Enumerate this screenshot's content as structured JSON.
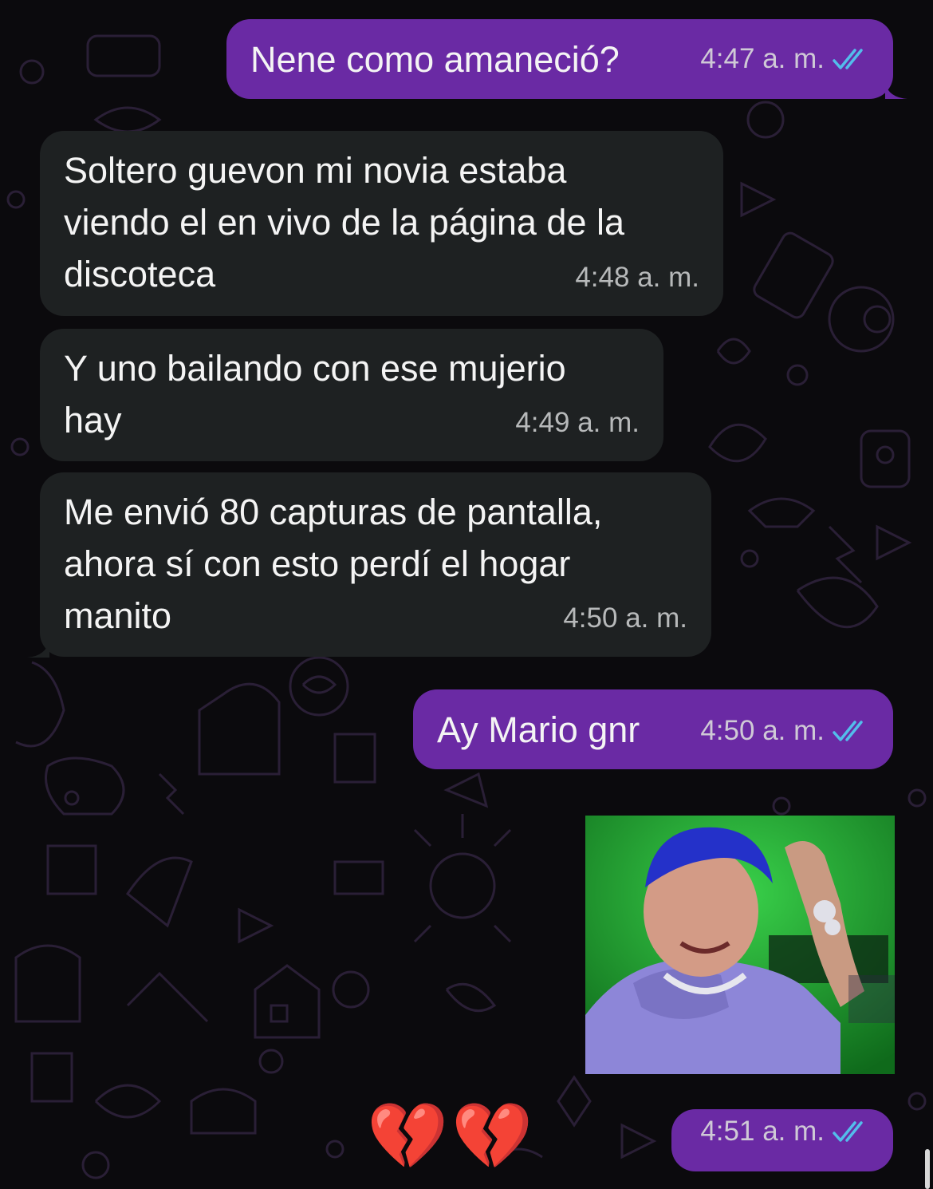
{
  "colors": {
    "outgoing_bubble": "#6a2aa4",
    "incoming_bubble": "#1e2122",
    "background": "#0b0a0d",
    "read_ticks": "#53bdeb"
  },
  "messages": [
    {
      "text": "Nene como amaneció?",
      "time": "4:47",
      "ampm": "a. m.",
      "direction": "outgoing",
      "status": "read"
    },
    {
      "text": "Soltero guevon mi novia estaba\nviendo el en vivo de la página de la\ndiscoteca",
      "time": "4:48",
      "ampm": "a. m.",
      "direction": "incoming"
    },
    {
      "text": "Y uno bailando con ese mujerio\nhay",
      "time": "4:49",
      "ampm": "a. m.",
      "direction": "incoming"
    },
    {
      "text": "Me envió 80 capturas de pantalla,\nahora sí con esto perdí el hogar\nmanito",
      "time": "4:50",
      "ampm": "a. m.",
      "direction": "incoming"
    },
    {
      "text": "Ay Mario gnr",
      "time": "4:50",
      "ampm": "a. m.",
      "direction": "outgoing",
      "status": "read"
    }
  ],
  "sticker": {
    "type": "image",
    "subject": "person with blue hair crying, green background"
  },
  "last_message": {
    "emoji": "💔💔",
    "time": "4:51",
    "ampm": "a. m.",
    "status": "read"
  }
}
